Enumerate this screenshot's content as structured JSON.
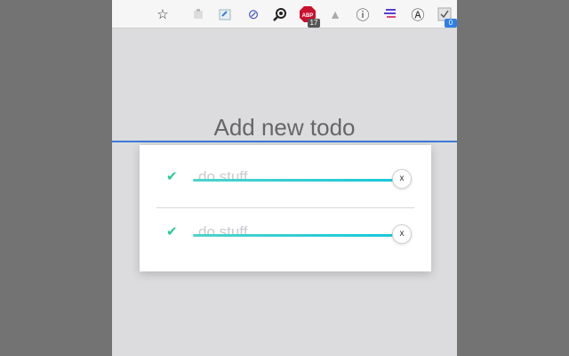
{
  "toolbar": {
    "icons": [
      {
        "name": "bookmark-star-icon",
        "glyph": "☆"
      },
      {
        "name": "extension-puzzle-icon",
        "glyph": ""
      },
      {
        "name": "extension-share-icon",
        "glyph": ""
      },
      {
        "name": "block-icon",
        "glyph": "⊘"
      },
      {
        "name": "search-extension-icon",
        "glyph": ""
      },
      {
        "name": "adblock-icon",
        "glyph": "ABP",
        "badge": "17"
      },
      {
        "name": "drive-icon",
        "glyph": "▲"
      },
      {
        "name": "info-icon",
        "glyph": "ⓘ"
      },
      {
        "name": "list-extension-icon",
        "glyph": "☰"
      },
      {
        "name": "a-extension-icon",
        "glyph": "Ⓐ"
      },
      {
        "name": "todo-extension-icon",
        "glyph": "",
        "badge": "0"
      }
    ]
  },
  "input": {
    "placeholder": "Add new todo"
  },
  "todos": [
    {
      "text": "do stuff",
      "completed": true,
      "delete_label": "x"
    },
    {
      "text": "do stuff",
      "completed": true,
      "delete_label": "x"
    }
  ],
  "colors": {
    "accent_blue": "#3a7bd5",
    "check_green": "#2cc79a",
    "strike_teal": "#17c8dc"
  }
}
